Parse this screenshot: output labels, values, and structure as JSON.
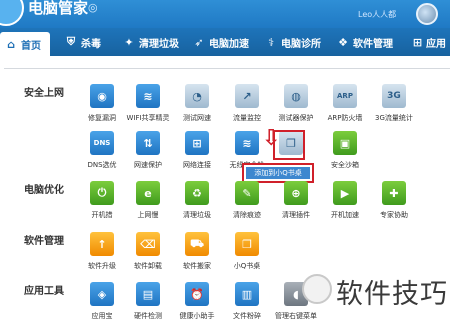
{
  "app": {
    "title": "电脑管家",
    "username": "Leo人人都",
    "logo_icon": "qq-guard-icon"
  },
  "tabs": [
    {
      "label": "首页",
      "icon": "home-icon",
      "active": true
    },
    {
      "label": "杀毒",
      "icon": "shield-icon"
    },
    {
      "label": "清理垃圾",
      "icon": "broom-icon"
    },
    {
      "label": "电脑加速",
      "icon": "rocket-icon"
    },
    {
      "label": "电脑诊所",
      "icon": "stethoscope-icon"
    },
    {
      "label": "软件管理",
      "icon": "software-icon"
    },
    {
      "label": "应用",
      "icon": "apps-icon"
    }
  ],
  "sections": {
    "security": "安全上网",
    "optimize": "电脑优化",
    "software": "软件管理",
    "tools": "应用工具"
  },
  "security_items": [
    {
      "label": "修复漏洞",
      "icon": "patch-icon",
      "glyph": "◉",
      "color": "blue"
    },
    {
      "label": "WIFI共享精灵",
      "icon": "wifi-icon",
      "glyph": "≋",
      "color": "blue"
    },
    {
      "label": "测试网速",
      "icon": "speedometer-icon",
      "glyph": "◔",
      "color": "gray"
    },
    {
      "label": "流量监控",
      "icon": "traffic-chart-icon",
      "glyph": "↗",
      "color": "gray"
    },
    {
      "label": "测试器保护",
      "icon": "globe-icon",
      "glyph": "◍",
      "color": "gray"
    },
    {
      "label": "ARP防火墙",
      "icon": "arp-icon",
      "glyph": "ARP",
      "color": "gray"
    },
    {
      "label": "3G流量统计",
      "icon": "3g-icon",
      "glyph": "3G",
      "color": "gray"
    },
    {
      "label": "DNS选优",
      "icon": "dns-icon",
      "glyph": "DNS",
      "color": "blue"
    },
    {
      "label": "网速保护",
      "icon": "network-shield-icon",
      "glyph": "⇅",
      "color": "blue"
    },
    {
      "label": "网络连接",
      "icon": "network-icon",
      "glyph": "⊞",
      "color": "blue"
    },
    {
      "label": "无线安全检",
      "icon": "wifi-shield-icon",
      "glyph": "≋",
      "color": "blue"
    },
    {
      "label": "",
      "icon": "qq-book-icon",
      "glyph": "❐",
      "color": "gray"
    },
    {
      "label": "安全沙箱",
      "icon": "sandbox-icon",
      "glyph": "▣",
      "color": "green"
    }
  ],
  "optimize_items": [
    {
      "label": "开机措",
      "icon": "power-icon",
      "glyph": "⏻",
      "color": "green"
    },
    {
      "label": "上网慢",
      "icon": "browser-icon",
      "glyph": "e",
      "color": "green"
    },
    {
      "label": "清理垃圾",
      "icon": "trash-icon",
      "glyph": "♻",
      "color": "green"
    },
    {
      "label": "清除痕迹",
      "icon": "eraser-icon",
      "glyph": "✎",
      "color": "green"
    },
    {
      "label": "清理插件",
      "icon": "plugin-icon",
      "glyph": "⊕",
      "color": "green"
    },
    {
      "label": "开机加速",
      "icon": "boost-icon",
      "glyph": "▶",
      "color": "green"
    },
    {
      "label": "专家协助",
      "icon": "expert-icon",
      "glyph": "✚",
      "color": "green"
    }
  ],
  "software_items": [
    {
      "label": "软件升级",
      "icon": "upgrade-icon",
      "glyph": "↑",
      "color": "orange"
    },
    {
      "label": "软件卸载",
      "icon": "uninstall-icon",
      "glyph": "⌫",
      "color": "orange"
    },
    {
      "label": "软件搬家",
      "icon": "truck-icon",
      "glyph": "⛟",
      "color": "orange"
    },
    {
      "label": "小Q书桌",
      "icon": "book-icon",
      "glyph": "❐",
      "color": "orange"
    }
  ],
  "tools_items": [
    {
      "label": "应用宝",
      "icon": "app-store-icon",
      "glyph": "◈",
      "color": "blue"
    },
    {
      "label": "硬件检测",
      "icon": "hardware-icon",
      "glyph": "▤",
      "color": "blue"
    },
    {
      "label": "健康小助手",
      "icon": "alarm-icon",
      "glyph": "⏰",
      "color": "blue"
    },
    {
      "label": "文件粉碎",
      "icon": "shredder-icon",
      "glyph": "▥",
      "color": "blue"
    },
    {
      "label": "管理右键菜单",
      "icon": "mouse-icon",
      "glyph": "◖",
      "color": "darkgray"
    }
  ],
  "popup": {
    "label": "添加到小Q书桌"
  },
  "watermark": {
    "text": "软件技巧"
  }
}
